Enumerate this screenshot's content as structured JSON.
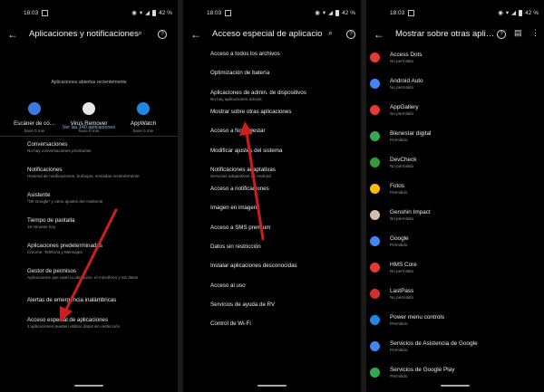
{
  "status": {
    "time": "18:03",
    "battery": "42 %"
  },
  "colors": {
    "background": "#000000",
    "link": "#8ab4f8",
    "arrow": "#cc1e1e"
  },
  "screen1": {
    "title": "Aplicaciones y notificaciones",
    "recent_header": "Aplicaciones abiertas recientemente",
    "recent_apps": [
      {
        "name": "Escáner de có…",
        "time": "hace 0 min",
        "color": "#3b7be0"
      },
      {
        "name": "Virus Remover",
        "time": "hace 0 min",
        "color": "#e8e8e8"
      },
      {
        "name": "AppWatch",
        "time": "hace 0 min",
        "color": "#1e88e5"
      }
    ],
    "view_all": "Ver las 140 aplicaciones",
    "items": [
      {
        "label": "Conversaciones",
        "desc": "No hay conversaciones prioritarias"
      },
      {
        "label": "Notificaciones",
        "desc": "Historial de notificaciones, burbujas, enviadas recientemente"
      },
      {
        "label": "Asistente",
        "desc": "\"Ok Google\" y otros ajustes del Asistente"
      },
      {
        "label": "Tiempo de pantalla",
        "desc": "16 minutos hoy"
      },
      {
        "label": "Aplicaciones predeterminadas",
        "desc": "Chrome, Teléfono y Mensajes"
      },
      {
        "label": "Gestor de permisos",
        "desc": "Aplicaciones que usan la ubicación, el micrófono y los datos"
      },
      {
        "label": "Alertas de emergencia inalámbricas",
        "desc": ""
      },
      {
        "label": "Acceso especial de aplicaciones",
        "desc": "2 aplicaciones pueden utilizar datos sin restricción"
      }
    ]
  },
  "screen2": {
    "title": "Acceso especial de aplicaciones",
    "items": [
      {
        "label": "Acceso a todos los archivos",
        "desc": ""
      },
      {
        "label": "Optimización de batería",
        "desc": ""
      },
      {
        "label": "Aplicaciones de admin. de dispositivos",
        "desc": "No hay aplicaciones activas"
      },
      {
        "label": "Mostrar sobre otras aplicaciones",
        "desc": ""
      },
      {
        "label": "Acceso a No molestar",
        "desc": ""
      },
      {
        "label": "Modificar ajustes del sistema",
        "desc": ""
      },
      {
        "label": "Notificaciones adaptativas",
        "desc": "Servicios adaptativos de Android"
      },
      {
        "label": "Acceso a notificaciones",
        "desc": ""
      },
      {
        "label": "Imagen en imagen",
        "desc": ""
      },
      {
        "label": "Acceso a SMS premium",
        "desc": ""
      },
      {
        "label": "Datos sin restricción",
        "desc": ""
      },
      {
        "label": "Instalar aplicaciones desconocidas",
        "desc": ""
      },
      {
        "label": "Acceso al uso",
        "desc": ""
      },
      {
        "label": "Servicios de ayuda de RV",
        "desc": ""
      },
      {
        "label": "Control de Wi-Fi",
        "desc": ""
      }
    ]
  },
  "screen3": {
    "title": "Mostrar sobre otras apli…",
    "apps": [
      {
        "name": "Access Dots",
        "status": "No permitido",
        "color": "#e53935"
      },
      {
        "name": "Android Auto",
        "status": "No permitido",
        "color": "#4285f4"
      },
      {
        "name": "AppGallery",
        "status": "No permitido",
        "color": "#e53935"
      },
      {
        "name": "Bienestar digital",
        "status": "Permitido",
        "color": "#34a853"
      },
      {
        "name": "DevCheck",
        "status": "No permitido",
        "color": "#2e9d3a"
      },
      {
        "name": "Fotos",
        "status": "Permitido",
        "color": "#fbbc05"
      },
      {
        "name": "Genshin Impact",
        "status": "No permitido",
        "color": "#cfc2a8"
      },
      {
        "name": "Google",
        "status": "Permitido",
        "color": "#4285f4"
      },
      {
        "name": "HMS Core",
        "status": "No permitido",
        "color": "#e53935"
      },
      {
        "name": "LastPass",
        "status": "No permitido",
        "color": "#d32f2f"
      },
      {
        "name": "Power menu controls",
        "status": "Permitido",
        "color": "#1e88e5"
      },
      {
        "name": "Servicios de Asistencia de Google",
        "status": "Permitido",
        "color": "#4285f4"
      },
      {
        "name": "Servicios de Google Play",
        "status": "Permitido",
        "color": "#34a853"
      }
    ]
  }
}
